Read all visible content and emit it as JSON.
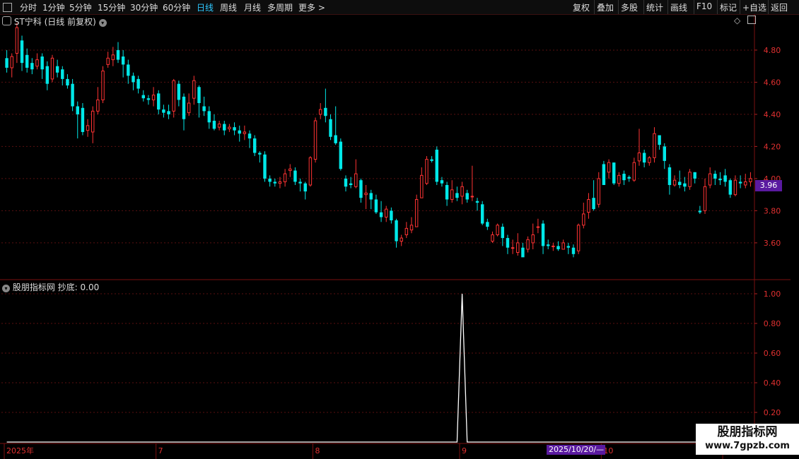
{
  "toolbar": {
    "left": [
      {
        "label": "分时",
        "active": false
      },
      {
        "label": "1分钟",
        "active": false
      },
      {
        "label": "5分钟",
        "active": false
      },
      {
        "label": "15分钟",
        "active": false
      },
      {
        "label": "30分钟",
        "active": false
      },
      {
        "label": "60分钟",
        "active": false
      },
      {
        "label": "日线",
        "active": true
      },
      {
        "label": "周线",
        "active": false
      },
      {
        "label": "月线",
        "active": false
      },
      {
        "label": "多周期",
        "active": false
      },
      {
        "label": "更多 >",
        "active": false
      }
    ],
    "right": [
      "复权",
      "叠加",
      "多股",
      "统计",
      "画线",
      "F10",
      "标记",
      "+自选",
      "返回"
    ]
  },
  "main_chart": {
    "title": "ST宁科 (日线 前复权)",
    "price_tag": "3.96",
    "y_ticks": [
      "4.80",
      "4.60",
      "4.40",
      "4.20",
      "4.00",
      "3.80",
      "3.60"
    ],
    "colors": {
      "up": "#ff3333",
      "down": "#00e8e8",
      "grid": "#5a1010"
    }
  },
  "indicator": {
    "title": "股朋指标网",
    "label": "抄底: 0.00",
    "y_ticks": [
      "1.00",
      "0.80",
      "0.60",
      "0.40",
      "0.20"
    ],
    "spike_index": 90,
    "spike_value": 1.0
  },
  "time_axis": {
    "labels": [
      {
        "text": "2025年",
        "i": 0
      },
      {
        "text": "7",
        "i": 30
      },
      {
        "text": "8",
        "i": 61
      },
      {
        "text": "9",
        "i": 90
      },
      {
        "text": "10",
        "i": 118
      },
      {
        "text": "11",
        "i": 142
      }
    ],
    "crosshair_date": "2025/10/20/—"
  },
  "watermark": {
    "title": "股朋指标网",
    "url": "www.7gpzb.com"
  },
  "chart_data": {
    "type": "candlestick",
    "ylim": [
      3.45,
      4.98
    ],
    "candles": [
      [
        4.75,
        4.69,
        4.8,
        4.66
      ],
      [
        4.69,
        4.76,
        4.78,
        4.63
      ],
      [
        4.78,
        4.94,
        4.97,
        4.72
      ],
      [
        4.86,
        4.72,
        4.89,
        4.67
      ],
      [
        4.77,
        4.69,
        4.81,
        4.66
      ],
      [
        4.72,
        4.68,
        4.75,
        4.65
      ],
      [
        4.7,
        4.74,
        4.78,
        4.68
      ],
      [
        4.76,
        4.68,
        4.78,
        4.62
      ],
      [
        4.7,
        4.59,
        4.73,
        4.55
      ],
      [
        4.62,
        4.75,
        4.77,
        4.6
      ],
      [
        4.7,
        4.66,
        4.74,
        4.63
      ],
      [
        4.68,
        4.62,
        4.7,
        4.58
      ],
      [
        4.62,
        4.58,
        4.65,
        4.56
      ],
      [
        4.59,
        4.45,
        4.62,
        4.42
      ],
      [
        4.45,
        4.4,
        4.48,
        4.25
      ],
      [
        4.44,
        4.29,
        4.47,
        4.27
      ],
      [
        4.3,
        4.33,
        4.37,
        4.26
      ],
      [
        4.29,
        4.42,
        4.45,
        4.22
      ],
      [
        4.42,
        4.49,
        4.57,
        4.4
      ],
      [
        4.49,
        4.67,
        4.7,
        4.47
      ],
      [
        4.71,
        4.75,
        4.79,
        4.69
      ],
      [
        4.74,
        4.77,
        4.82,
        4.7
      ],
      [
        4.8,
        4.74,
        4.85,
        4.72
      ],
      [
        4.76,
        4.71,
        4.8,
        4.63
      ],
      [
        4.71,
        4.64,
        4.74,
        4.59
      ],
      [
        4.64,
        4.6,
        4.66,
        4.55
      ],
      [
        4.62,
        4.56,
        4.64,
        4.53
      ],
      [
        4.52,
        4.5,
        4.55,
        4.48
      ],
      [
        4.5,
        4.49,
        4.52,
        4.46
      ],
      [
        4.49,
        4.52,
        4.57,
        4.45
      ],
      [
        4.53,
        4.43,
        4.55,
        4.4
      ],
      [
        4.43,
        4.41,
        4.46,
        4.38
      ],
      [
        4.42,
        4.4,
        4.46,
        4.37
      ],
      [
        4.42,
        4.61,
        4.62,
        4.38
      ],
      [
        4.59,
        4.49,
        4.61,
        4.45
      ],
      [
        4.51,
        4.37,
        4.53,
        4.3
      ],
      [
        4.41,
        4.47,
        4.53,
        4.39
      ],
      [
        4.5,
        4.61,
        4.64,
        4.46
      ],
      [
        4.57,
        4.47,
        4.58,
        4.38
      ],
      [
        4.45,
        4.42,
        4.51,
        4.39
      ],
      [
        4.42,
        4.35,
        4.45,
        4.31
      ],
      [
        4.36,
        4.31,
        4.4,
        4.3
      ],
      [
        4.32,
        4.34,
        4.36,
        4.3
      ],
      [
        4.34,
        4.3,
        4.36,
        4.27
      ],
      [
        4.31,
        4.32,
        4.34,
        4.29
      ],
      [
        4.32,
        4.3,
        4.35,
        4.27
      ],
      [
        4.3,
        4.28,
        4.33,
        4.23
      ],
      [
        4.28,
        4.29,
        4.33,
        4.24
      ],
      [
        4.28,
        4.25,
        4.3,
        4.19
      ],
      [
        4.25,
        4.16,
        4.27,
        4.14
      ],
      [
        4.16,
        4.15,
        4.17,
        4.1
      ],
      [
        4.15,
        4.0,
        4.17,
        3.98
      ],
      [
        4.0,
        3.98,
        4.02,
        3.95
      ],
      [
        3.98,
        3.97,
        4.0,
        3.95
      ],
      [
        3.97,
        3.98,
        4.01,
        3.94
      ],
      [
        3.98,
        4.03,
        4.06,
        3.95
      ],
      [
        4.05,
        4.06,
        4.09,
        4.01
      ],
      [
        4.05,
        3.98,
        4.07,
        3.96
      ],
      [
        3.98,
        3.97,
        4.0,
        3.92
      ],
      [
        3.97,
        3.92,
        3.98,
        3.87
      ],
      [
        3.96,
        4.13,
        4.14,
        3.95
      ],
      [
        4.12,
        4.36,
        4.38,
        4.1
      ],
      [
        4.4,
        4.43,
        4.47,
        4.37
      ],
      [
        4.44,
        4.39,
        4.56,
        4.35
      ],
      [
        4.37,
        4.26,
        4.4,
        4.24
      ],
      [
        4.27,
        4.22,
        4.45,
        4.21
      ],
      [
        4.23,
        4.06,
        4.25,
        4.05
      ],
      [
        4.0,
        3.95,
        4.02,
        3.92
      ],
      [
        3.97,
        3.96,
        4.01,
        3.94
      ],
      [
        3.95,
        4.03,
        4.12,
        3.94
      ],
      [
        3.99,
        3.88,
        4.0,
        3.85
      ],
      [
        3.9,
        3.91,
        3.96,
        3.81
      ],
      [
        3.91,
        3.87,
        3.93,
        3.81
      ],
      [
        3.87,
        3.79,
        3.9,
        3.78
      ],
      [
        3.79,
        3.76,
        3.86,
        3.73
      ],
      [
        3.76,
        3.81,
        3.83,
        3.73
      ],
      [
        3.8,
        3.74,
        3.82,
        3.72
      ],
      [
        3.74,
        3.61,
        3.75,
        3.57
      ],
      [
        3.61,
        3.63,
        3.65,
        3.58
      ],
      [
        3.65,
        3.69,
        3.73,
        3.63
      ],
      [
        3.68,
        3.71,
        3.76,
        3.66
      ],
      [
        3.7,
        3.87,
        3.9,
        3.7
      ],
      [
        3.88,
        4.02,
        4.07,
        3.88
      ],
      [
        3.97,
        4.12,
        4.14,
        3.96
      ],
      [
        4.12,
        4.11,
        4.14,
        4.1
      ],
      [
        4.18,
        3.98,
        4.2,
        3.96
      ],
      [
        3.99,
        3.97,
        4.01,
        3.95
      ],
      [
        3.96,
        3.87,
        3.98,
        3.83
      ],
      [
        3.87,
        3.93,
        3.99,
        3.85
      ],
      [
        3.91,
        3.88,
        3.95,
        3.86
      ],
      [
        3.89,
        3.95,
        3.98,
        3.84
      ],
      [
        3.91,
        3.87,
        3.93,
        3.85
      ],
      [
        3.89,
        3.89,
        4.08,
        3.86
      ],
      [
        3.86,
        3.85,
        3.88,
        3.8
      ],
      [
        3.84,
        3.72,
        3.86,
        3.71
      ],
      [
        3.73,
        3.7,
        3.75,
        3.68
      ],
      [
        3.61,
        3.65,
        3.67,
        3.6
      ],
      [
        3.65,
        3.71,
        3.72,
        3.64
      ],
      [
        3.7,
        3.63,
        3.72,
        3.58
      ],
      [
        3.63,
        3.57,
        3.65,
        3.53
      ],
      [
        3.57,
        3.57,
        3.62,
        3.53
      ],
      [
        3.54,
        3.6,
        3.66,
        3.52
      ],
      [
        3.57,
        3.51,
        3.6,
        3.52
      ],
      [
        3.56,
        3.62,
        3.64,
        3.54
      ],
      [
        3.6,
        3.65,
        3.72,
        3.56
      ],
      [
        3.7,
        3.7,
        3.75,
        3.66
      ],
      [
        3.72,
        3.58,
        3.74,
        3.53
      ],
      [
        3.59,
        3.58,
        3.62,
        3.56
      ],
      [
        3.58,
        3.58,
        3.6,
        3.55
      ],
      [
        3.58,
        3.56,
        3.61,
        3.55
      ],
      [
        3.56,
        3.6,
        3.62,
        3.56
      ],
      [
        3.58,
        3.57,
        3.6,
        3.53
      ],
      [
        3.57,
        3.53,
        3.59,
        3.51
      ],
      [
        3.55,
        3.71,
        3.72,
        3.53
      ],
      [
        3.71,
        3.78,
        3.85,
        3.69
      ],
      [
        3.79,
        3.87,
        3.91,
        3.75
      ],
      [
        3.88,
        3.81,
        3.99,
        3.8
      ],
      [
        3.84,
        4.0,
        4.04,
        3.82
      ],
      [
        4.09,
        3.96,
        4.11,
        3.96
      ],
      [
        4.04,
        4.1,
        4.12,
        4.0
      ],
      [
        4.1,
        3.97,
        4.1,
        3.96
      ],
      [
        3.97,
        4.02,
        4.04,
        3.95
      ],
      [
        4.03,
        3.99,
        4.05,
        3.96
      ],
      [
        4.01,
        4.0,
        4.02,
        3.98
      ],
      [
        3.99,
        4.1,
        4.13,
        3.98
      ],
      [
        4.11,
        4.16,
        4.31,
        4.08
      ],
      [
        4.16,
        4.1,
        4.18,
        4.07
      ],
      [
        4.1,
        4.13,
        4.14,
        4.08
      ],
      [
        4.13,
        4.28,
        4.32,
        4.1
      ],
      [
        4.27,
        4.21,
        4.26,
        4.18
      ],
      [
        4.2,
        4.11,
        4.22,
        4.06
      ],
      [
        4.07,
        3.96,
        4.09,
        3.9
      ],
      [
        3.96,
        3.99,
        4.02,
        3.95
      ],
      [
        3.98,
        3.96,
        4.05,
        3.94
      ],
      [
        3.97,
        3.95,
        4.01,
        3.92
      ],
      [
        3.95,
        4.04,
        4.06,
        3.93
      ],
      [
        4.04,
        4.0,
        4.04,
        3.97
      ],
      [
        3.8,
        3.79,
        3.83,
        3.78
      ],
      [
        3.8,
        3.95,
        4.0,
        3.78
      ],
      [
        3.96,
        4.03,
        4.07,
        3.94
      ],
      [
        4.03,
        4.0,
        4.05,
        3.96
      ],
      [
        4.0,
        3.99,
        4.04,
        3.96
      ],
      [
        4.02,
        3.98,
        4.06,
        3.95
      ],
      [
        3.99,
        3.9,
        4.0,
        3.88
      ],
      [
        3.9,
        3.99,
        4.02,
        3.89
      ],
      [
        3.98,
        3.97,
        4.02,
        3.94
      ],
      [
        3.96,
        3.98,
        4.03,
        3.94
      ],
      [
        3.98,
        4.0,
        4.04,
        3.95
      ]
    ]
  }
}
